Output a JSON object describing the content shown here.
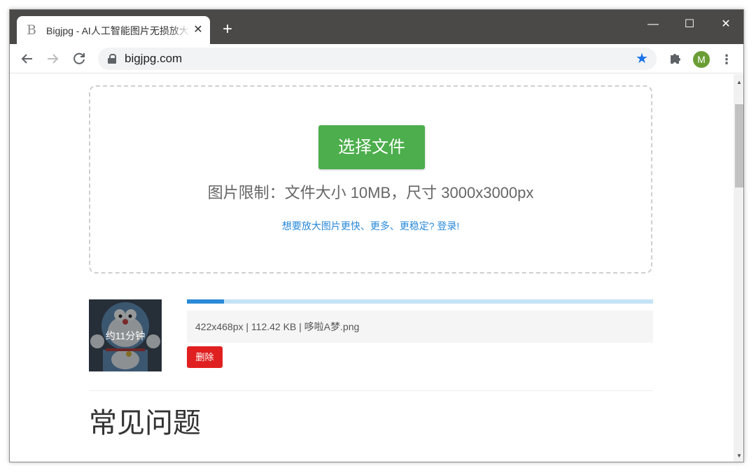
{
  "browser": {
    "tab_title": "Bigjpg - AI人工智能图片无损放大",
    "favicon_glyph": "B",
    "tab_close_glyph": "✕",
    "new_tab_glyph": "+",
    "url": "bigjpg.com",
    "avatar_letter": "M",
    "minimize_glyph": "—",
    "maximize_glyph": "☐",
    "close_glyph": "✕",
    "icons": [
      "back-arrow-icon",
      "forward-arrow-icon",
      "reload-icon",
      "lock-icon",
      "star-icon",
      "extensions-puzzle-icon",
      "menu-dots-icon"
    ],
    "colors": {
      "titlebar": "#4a4948",
      "star": "#1a73e8",
      "avatar": "#6a9d34"
    }
  },
  "upload": {
    "select_button": "选择文件",
    "limit_text": "图片限制：文件大小 10MB，尺寸 3000x3000px",
    "login_link": "想要放大图片更快、更多、更稳定? 登录!"
  },
  "job": {
    "thumb_label": "约11分钟",
    "progress": 0.08,
    "file_info": "422x468px | 112.42 KB | 哆啦A梦.png",
    "delete_button": "删除",
    "colors": {
      "progress_fill": "#2a8ad8",
      "progress_track": "#c5e2f7",
      "delete": "#e02020"
    }
  },
  "faq": {
    "title": "常见问题"
  }
}
